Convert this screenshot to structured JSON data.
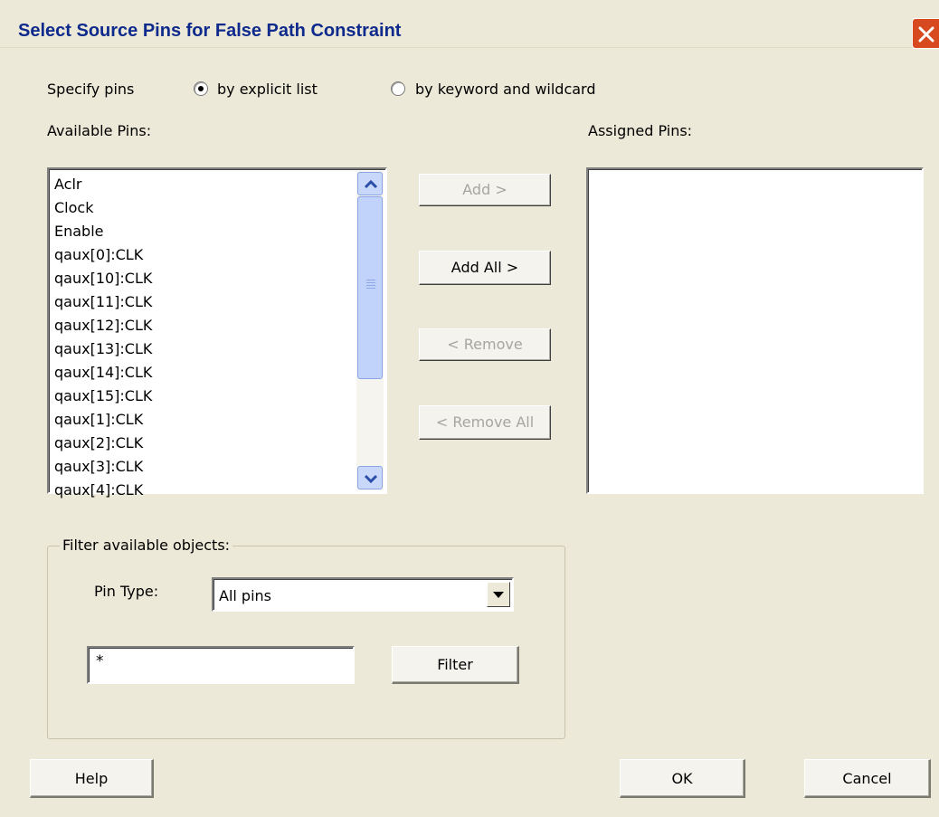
{
  "window": {
    "title": "Select Source Pins for False Path Constraint"
  },
  "specify": {
    "label": "Specify pins",
    "options": [
      {
        "label": "by explicit list",
        "selected": true
      },
      {
        "label": "by keyword and wildcard",
        "selected": false
      }
    ]
  },
  "available": {
    "label": "Available Pins:",
    "items": [
      "Aclr",
      "Clock",
      "Enable",
      "qaux[0]:CLK",
      "qaux[10]:CLK",
      "qaux[11]:CLK",
      "qaux[12]:CLK",
      "qaux[13]:CLK",
      "qaux[14]:CLK",
      "qaux[15]:CLK",
      "qaux[1]:CLK",
      "qaux[2]:CLK",
      "qaux[3]:CLK",
      "qaux[4]:CLK"
    ]
  },
  "assigned": {
    "label": "Assigned Pins:",
    "items": []
  },
  "buttons": {
    "add": "Add >",
    "add_all": "Add All >",
    "remove": "< Remove",
    "remove_all": "< Remove All",
    "help": "Help",
    "ok": "OK",
    "cancel": "Cancel"
  },
  "filter": {
    "group_label": "Filter available objects:",
    "pin_type_label": "Pin Type:",
    "pin_type_value": "All pins",
    "pattern": "*",
    "filter_button": "Filter"
  }
}
